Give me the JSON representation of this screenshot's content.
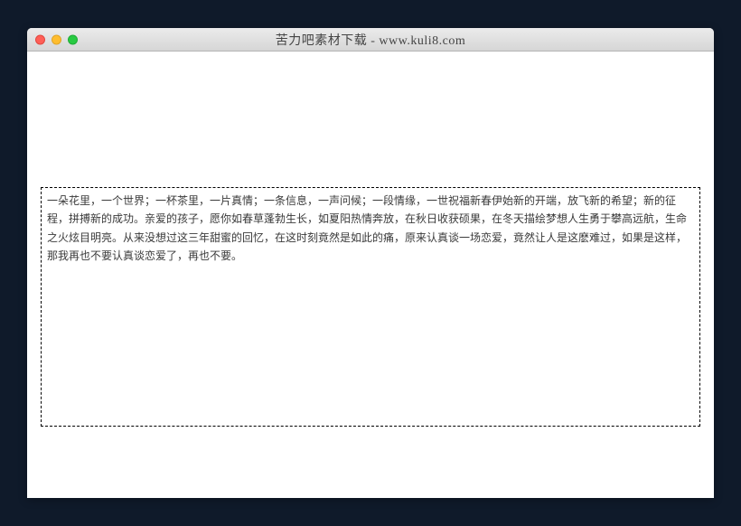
{
  "window": {
    "title": "苦力吧素材下载 - www.kuli8.com"
  },
  "content": {
    "body_text": "一朵花里，一个世界；一杯茶里，一片真情；一条信息，一声问候；一段情缘，一世祝福新春伊始新的开端，放飞新的希望；新的征程，拼搏新的成功。亲爱的孩子，愿你如春草蓬勃生长，如夏阳热情奔放，在秋日收获硕果，在冬天描绘梦想人生勇于攀高远航，生命之火炫目明亮。从来没想过这三年甜蜜的回忆，在这时刻竟然是如此的痛，原来认真谈一场恋爱，竟然让人是这麽难过，如果是这样，那我再也不要认真谈恋爱了，再也不要。"
  }
}
